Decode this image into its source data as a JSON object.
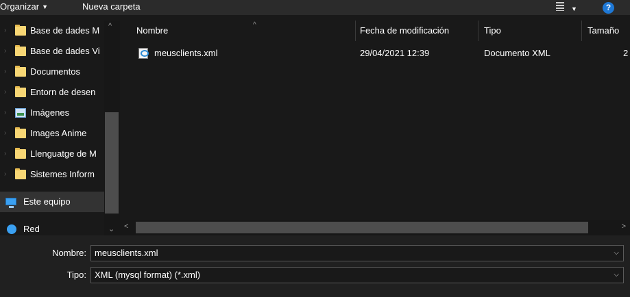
{
  "toolbar": {
    "organize_label": "Organizar",
    "new_folder_label": "Nueva carpeta",
    "view_icon": "view-options-icon",
    "help_label": "?"
  },
  "nav": {
    "items": [
      {
        "label": "Base de dades M",
        "icon": "folder-icon"
      },
      {
        "label": "Base de dades Vi",
        "icon": "folder-icon"
      },
      {
        "label": "Documentos",
        "icon": "folder-icon"
      },
      {
        "label": "Entorn de desen",
        "icon": "folder-icon"
      },
      {
        "label": "Imágenes",
        "icon": "pictures-icon"
      },
      {
        "label": "Images Anime",
        "icon": "folder-icon"
      },
      {
        "label": "Llenguatge de M",
        "icon": "folder-icon"
      },
      {
        "label": "Sistemes Inform",
        "icon": "folder-icon"
      },
      {
        "label": "Este equipo",
        "icon": "computer-icon"
      },
      {
        "label": "Red",
        "icon": "network-icon"
      }
    ]
  },
  "list": {
    "columns": [
      "Nombre",
      "Fecha de modificación",
      "Tipo",
      "Tamaño"
    ],
    "rows": [
      {
        "name": "meusclients.xml",
        "modified": "29/04/2021 12:39",
        "type": "Documento XML",
        "size": "2"
      }
    ]
  },
  "form": {
    "filename_label": "Nombre:",
    "filename_value": "meusclients.xml",
    "type_label": "Tipo:",
    "type_value": "XML (mysql format) (*.xml)"
  },
  "colors": {
    "background": "#191919",
    "toolbar": "#2b2b2b",
    "folder": "#f8d775",
    "help": "#1e78d6"
  }
}
